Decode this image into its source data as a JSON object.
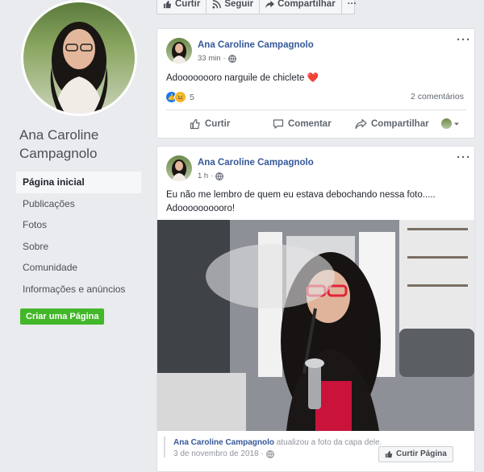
{
  "profile": {
    "name": "Ana Caroline Campagnolo"
  },
  "nav": {
    "items": [
      {
        "label": "Página inicial",
        "active": true
      },
      {
        "label": "Publicações"
      },
      {
        "label": "Fotos"
      },
      {
        "label": "Sobre"
      },
      {
        "label": "Comunidade"
      },
      {
        "label": "Informações e anúncios"
      }
    ],
    "create_page": "Criar uma Página"
  },
  "action_bar": {
    "like": "Curtir",
    "follow": "Seguir",
    "share": "Compartilhar",
    "more": "···"
  },
  "posts": [
    {
      "author": "Ana Caroline Campagnolo",
      "time": "33 min",
      "text": "Adoooooooro narguile de chiclete ❤️",
      "reactions_count": "5",
      "comments": "2 comentários",
      "actions": {
        "like": "Curtir",
        "comment": "Comentar",
        "share": "Compartilhar"
      }
    },
    {
      "author": "Ana Caroline Campagnolo",
      "time": "1 h",
      "text_line1": "Eu não me lembro de quem eu estava debochando nessa foto.....",
      "text_line2": "Adoooooooooro!",
      "shared_action": "atualizou a foto da capa dele.",
      "shared_date": "3 de novembro de 2018",
      "like_page": "Curtir Página"
    }
  ],
  "colors": {
    "link": "#365899",
    "green": "#42b72a",
    "heart": "#e0245e"
  }
}
